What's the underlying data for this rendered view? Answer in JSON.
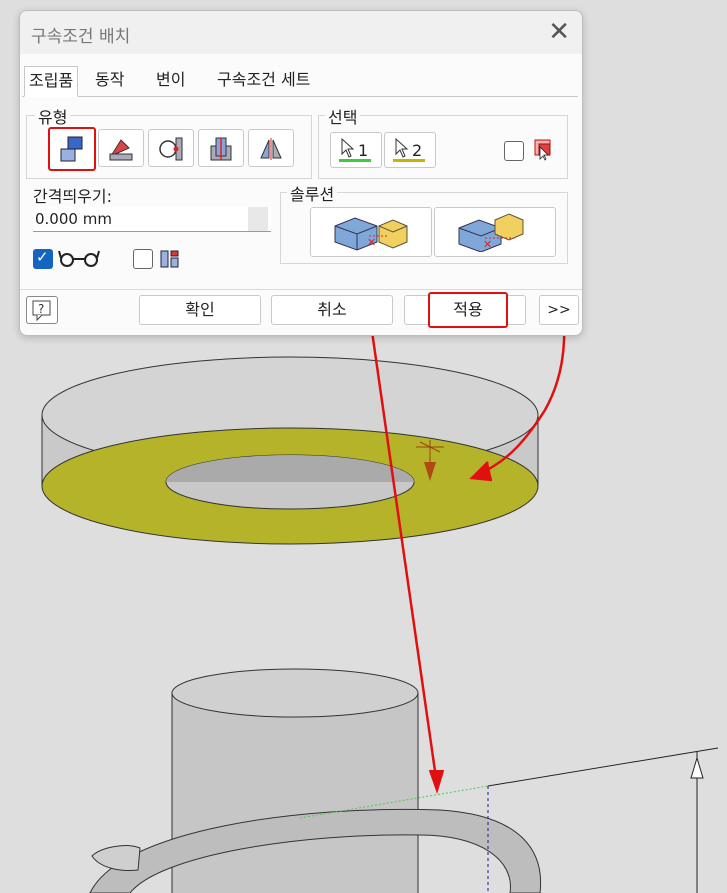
{
  "dialog": {
    "title": "구속조건 배치",
    "close_icon": "close-icon"
  },
  "tabs": [
    {
      "label": "조립품",
      "active": true
    },
    {
      "label": "동작",
      "active": false
    },
    {
      "label": "변이",
      "active": false
    },
    {
      "label": "구속조건 세트",
      "active": false
    }
  ],
  "type_group": {
    "label": "유형",
    "buttons": [
      {
        "icon": "mate-constraint-icon",
        "selected": true
      },
      {
        "icon": "angle-constraint-icon",
        "selected": false
      },
      {
        "icon": "tangent-constraint-icon",
        "selected": false
      },
      {
        "icon": "insert-constraint-icon",
        "selected": false
      },
      {
        "icon": "symmetry-constraint-icon",
        "selected": false
      }
    ]
  },
  "selections": {
    "label": "선택",
    "first": {
      "number": "1",
      "color": "#3ccb3c"
    },
    "second": {
      "number": "2",
      "color": "#c8b400"
    }
  },
  "offset": {
    "label": "간격띄우기:",
    "value": "0.000 mm"
  },
  "solution": {
    "label": "솔루션",
    "options": [
      {
        "icon": "mate-solution-icon"
      },
      {
        "icon": "flush-solution-icon"
      }
    ]
  },
  "options": {
    "show_preview_checked": true,
    "predict_offset_checked": false
  },
  "footer": {
    "ok": "확인",
    "cancel": "취소",
    "apply": "적용",
    "more": ">>"
  },
  "colors": {
    "highlight_face": "#b5b329",
    "annotation_red": "#e01010",
    "checkbox_blue": "#1565c0"
  }
}
